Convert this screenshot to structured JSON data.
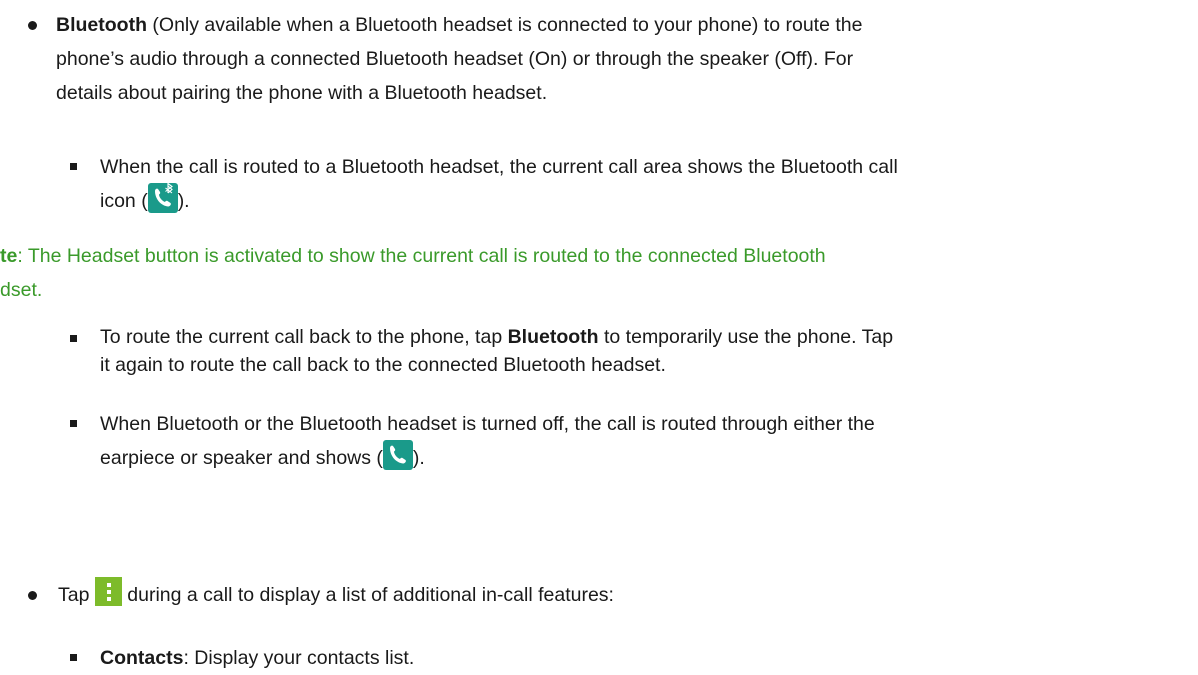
{
  "bullet1": {
    "title": "Bluetooth",
    "text_line1": " (Only available when a Bluetooth headset is connected to your phone) to route the",
    "text_line2": "phone’s audio through a connected Bluetooth headset (On) or through the speaker (Off). For",
    "text_line3": "details about pairing the phone with a Bluetooth headset."
  },
  "sub1": {
    "line1": "When the call is routed to a Bluetooth headset, the current call area shows the Bluetooth call",
    "line2_before": "icon (",
    "line2_after": ")."
  },
  "note": {
    "prefix": "te",
    "line1": ": The Headset button is activated to show the current call is routed to the connected Bluetooth",
    "line2": "dset."
  },
  "sub2": {
    "before": "To route the current call back to the phone, tap ",
    "bold": "Bluetooth",
    "after": " to temporarily use the phone. Tap",
    "line2": "it again to route the call back to the connected Bluetooth headset."
  },
  "sub3": {
    "line1": "When Bluetooth or the Bluetooth headset is turned off, the call is routed through either the",
    "line2_before": "earpiece or speaker and shows (",
    "line2_after": ")."
  },
  "bullet2": {
    "before": "Tap ",
    "after": " during a call to display a list of additional in-call features:"
  },
  "sub4": {
    "bold": "Contacts",
    "text": ": Display your contacts list."
  },
  "icons": {
    "bluetooth_call": "bluetooth-call-icon",
    "call": "call-icon",
    "menu": "more-menu-icon"
  },
  "colors": {
    "note_green": "#3a9a2a",
    "icon_teal": "#1a9a8a",
    "menu_green": "#7dbb2a"
  }
}
